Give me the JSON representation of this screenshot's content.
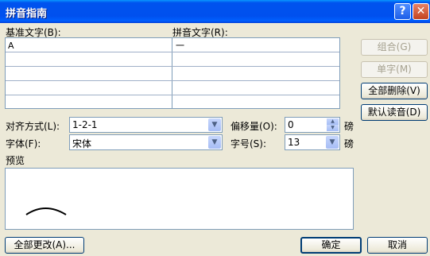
{
  "window": {
    "title": "拼音指南",
    "help_glyph": "?",
    "close_glyph": "✕"
  },
  "columns": {
    "base_label": "基准文字(B):",
    "ruby_label": "拼音文字(R):"
  },
  "rows": [
    {
      "base": "A",
      "ruby": "一"
    },
    {
      "base": "",
      "ruby": ""
    },
    {
      "base": "",
      "ruby": ""
    },
    {
      "base": "",
      "ruby": ""
    },
    {
      "base": "",
      "ruby": ""
    }
  ],
  "side_buttons": {
    "group": "组合(G)",
    "mono": "单字(M)",
    "clear_all": "全部删除(V)",
    "default_reading": "默认读音(D)"
  },
  "options": {
    "alignment_label": "对齐方式(L):",
    "alignment_value": "1-2-1",
    "offset_label": "偏移量(O):",
    "offset_value": "0",
    "offset_unit": "磅",
    "font_label": "字体(F):",
    "font_value": "宋体",
    "size_label": "字号(S):",
    "size_value": "13",
    "size_unit": "磅"
  },
  "preview": {
    "label": "预览",
    "ruby_glyph": "一"
  },
  "footer": {
    "change_all": "全部更改(A)...",
    "ok": "确定",
    "cancel": "取消"
  }
}
